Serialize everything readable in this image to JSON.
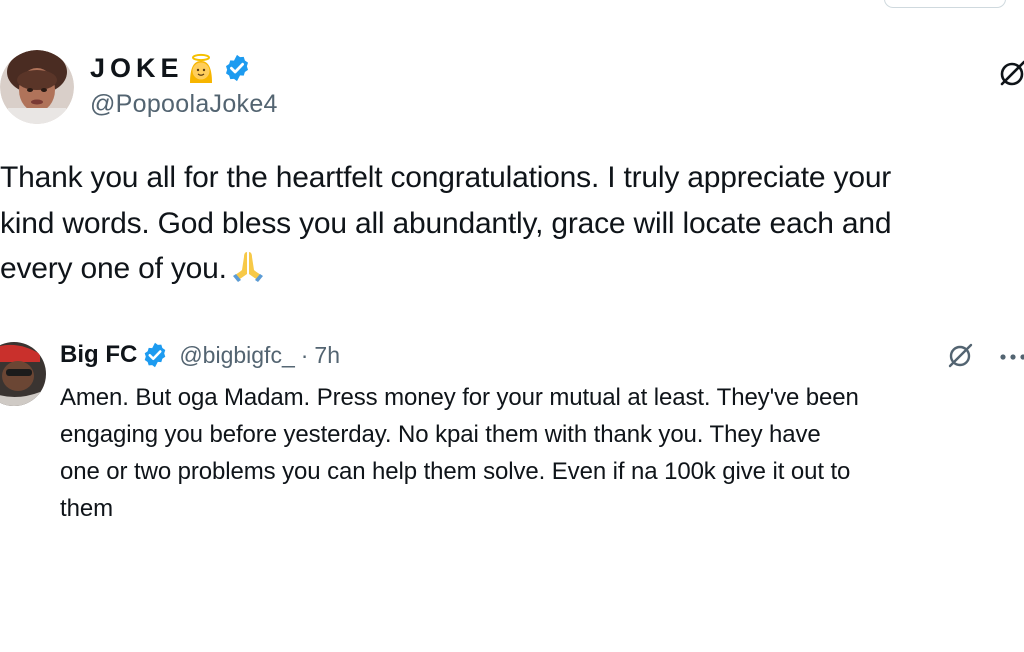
{
  "main_tweet": {
    "display_name": "JOKE",
    "handle": "@PopoolaJoke4",
    "text_lines": [
      "Thank you all for the heartfelt congratulations. I truly appreciate your",
      "kind words. God bless you all abundantly, grace will locate each and",
      "every one of you."
    ],
    "icons": [
      "angel-emoji-icon",
      "verified-badge-icon",
      "grok-icon",
      "folded-hands-emoji-icon"
    ]
  },
  "reply_tweet": {
    "display_name": "Big FC",
    "handle": "@bigbigfc_",
    "separator": "·",
    "time": "7h",
    "text_lines": [
      "Amen.  But oga Madam. Press money for your mutual at least. They've been",
      "engaging you before yesterday. No kpai them with thank you. They have",
      "one or two problems you can help them solve. Even if na 100k give it out to",
      "them"
    ],
    "icons": [
      "verified-badge-icon",
      "grok-icon",
      "more-options-icon"
    ]
  },
  "colors": {
    "text": "#0f1419",
    "secondary_text": "#536471",
    "verified_blue": "#1d9bf0",
    "background": "#ffffff"
  }
}
